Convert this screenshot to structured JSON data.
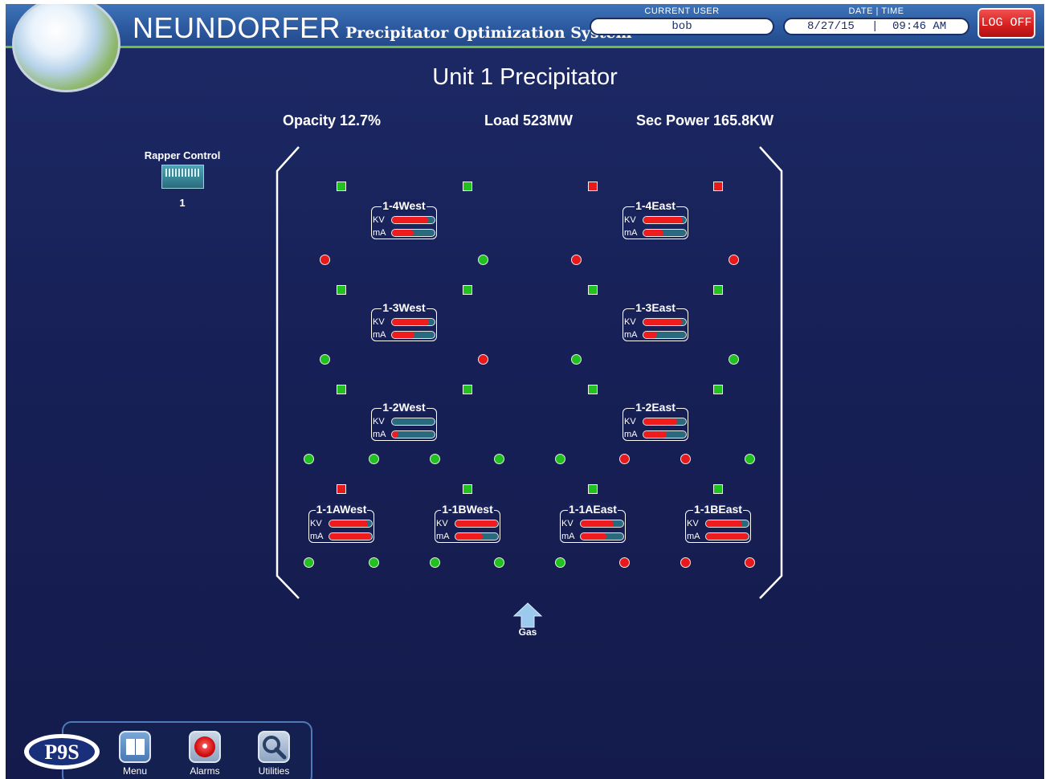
{
  "header": {
    "brand": "NEUNDORFER",
    "subtitle": "Precipitator Optimization System",
    "current_user_label": "CURRENT USER",
    "current_user": "bob",
    "datetime_label": "DATE | TIME",
    "date": "8/27/15",
    "time": "09:46 AM",
    "logoff_label": "LOG OFF"
  },
  "page_title": "Unit 1 Precipitator",
  "metrics": {
    "opacity": "Opacity 12.7%",
    "load": "Load 523MW",
    "sec_power": "Sec Power 165.8KW"
  },
  "rapper_control": {
    "label": "Rapper Control",
    "number": "1"
  },
  "tr_bar_labels": {
    "kv": "KV",
    "ma": "mA"
  },
  "transformers": [
    {
      "name": "1-4West",
      "kv": 0.85,
      "ma": 0.5
    },
    {
      "name": "1-4East",
      "kv": 0.92,
      "ma": 0.48
    },
    {
      "name": "1-3West",
      "kv": 0.86,
      "ma": 0.52
    },
    {
      "name": "1-3East",
      "kv": 0.9,
      "ma": 0.32
    },
    {
      "name": "1-2West",
      "kv": 0.0,
      "ma": 0.15
    },
    {
      "name": "1-2East",
      "kv": 0.8,
      "ma": 0.55
    },
    {
      "name": "1-1AWest",
      "kv": 0.9,
      "ma": 0.98
    },
    {
      "name": "1-1BWest",
      "kv": 0.98,
      "ma": 0.65
    },
    {
      "name": "1-1AEast",
      "kv": 0.78,
      "ma": 0.6
    },
    {
      "name": "1-1BEast",
      "kv": 0.85,
      "ma": 0.98
    }
  ],
  "square_status_rows": [
    [
      "green",
      "green",
      "red",
      "red"
    ],
    [
      "green",
      "green",
      "green",
      "green"
    ],
    [
      "green",
      "green",
      "green",
      "green"
    ],
    [
      "red",
      "green",
      "green",
      "green"
    ]
  ],
  "dot_status_rows": [
    [
      "red",
      "green",
      "red",
      "red"
    ],
    [
      "green",
      "red",
      "green",
      "green"
    ],
    [
      "green",
      "green",
      "green",
      "green",
      "green",
      "red",
      "red",
      "green"
    ],
    [
      "green",
      "green",
      "green",
      "green",
      "green",
      "red",
      "red",
      "red"
    ]
  ],
  "gas_label": "Gas",
  "status_colors": {
    "green": "#21c21f",
    "red": "#e8191b"
  },
  "nav": {
    "logo": "P9S",
    "menu": "Menu",
    "alarms": "Alarms",
    "utilities": "Utilities"
  }
}
